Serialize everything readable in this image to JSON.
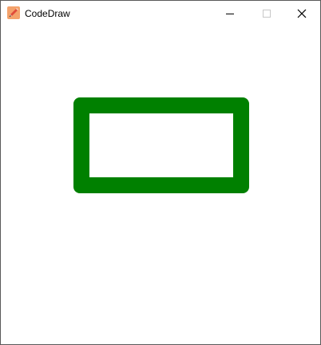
{
  "window": {
    "title": "CodeDraw"
  },
  "icons": {
    "app": "pencil-app-icon",
    "minimize": "minimize-icon",
    "maximize": "maximize-icon",
    "close": "close-icon"
  },
  "canvas": {
    "background": "#ffffff",
    "shapes": [
      {
        "type": "rounded-rectangle-outline",
        "stroke_color": "#008000",
        "fill_color": "#ffffff"
      }
    ]
  }
}
